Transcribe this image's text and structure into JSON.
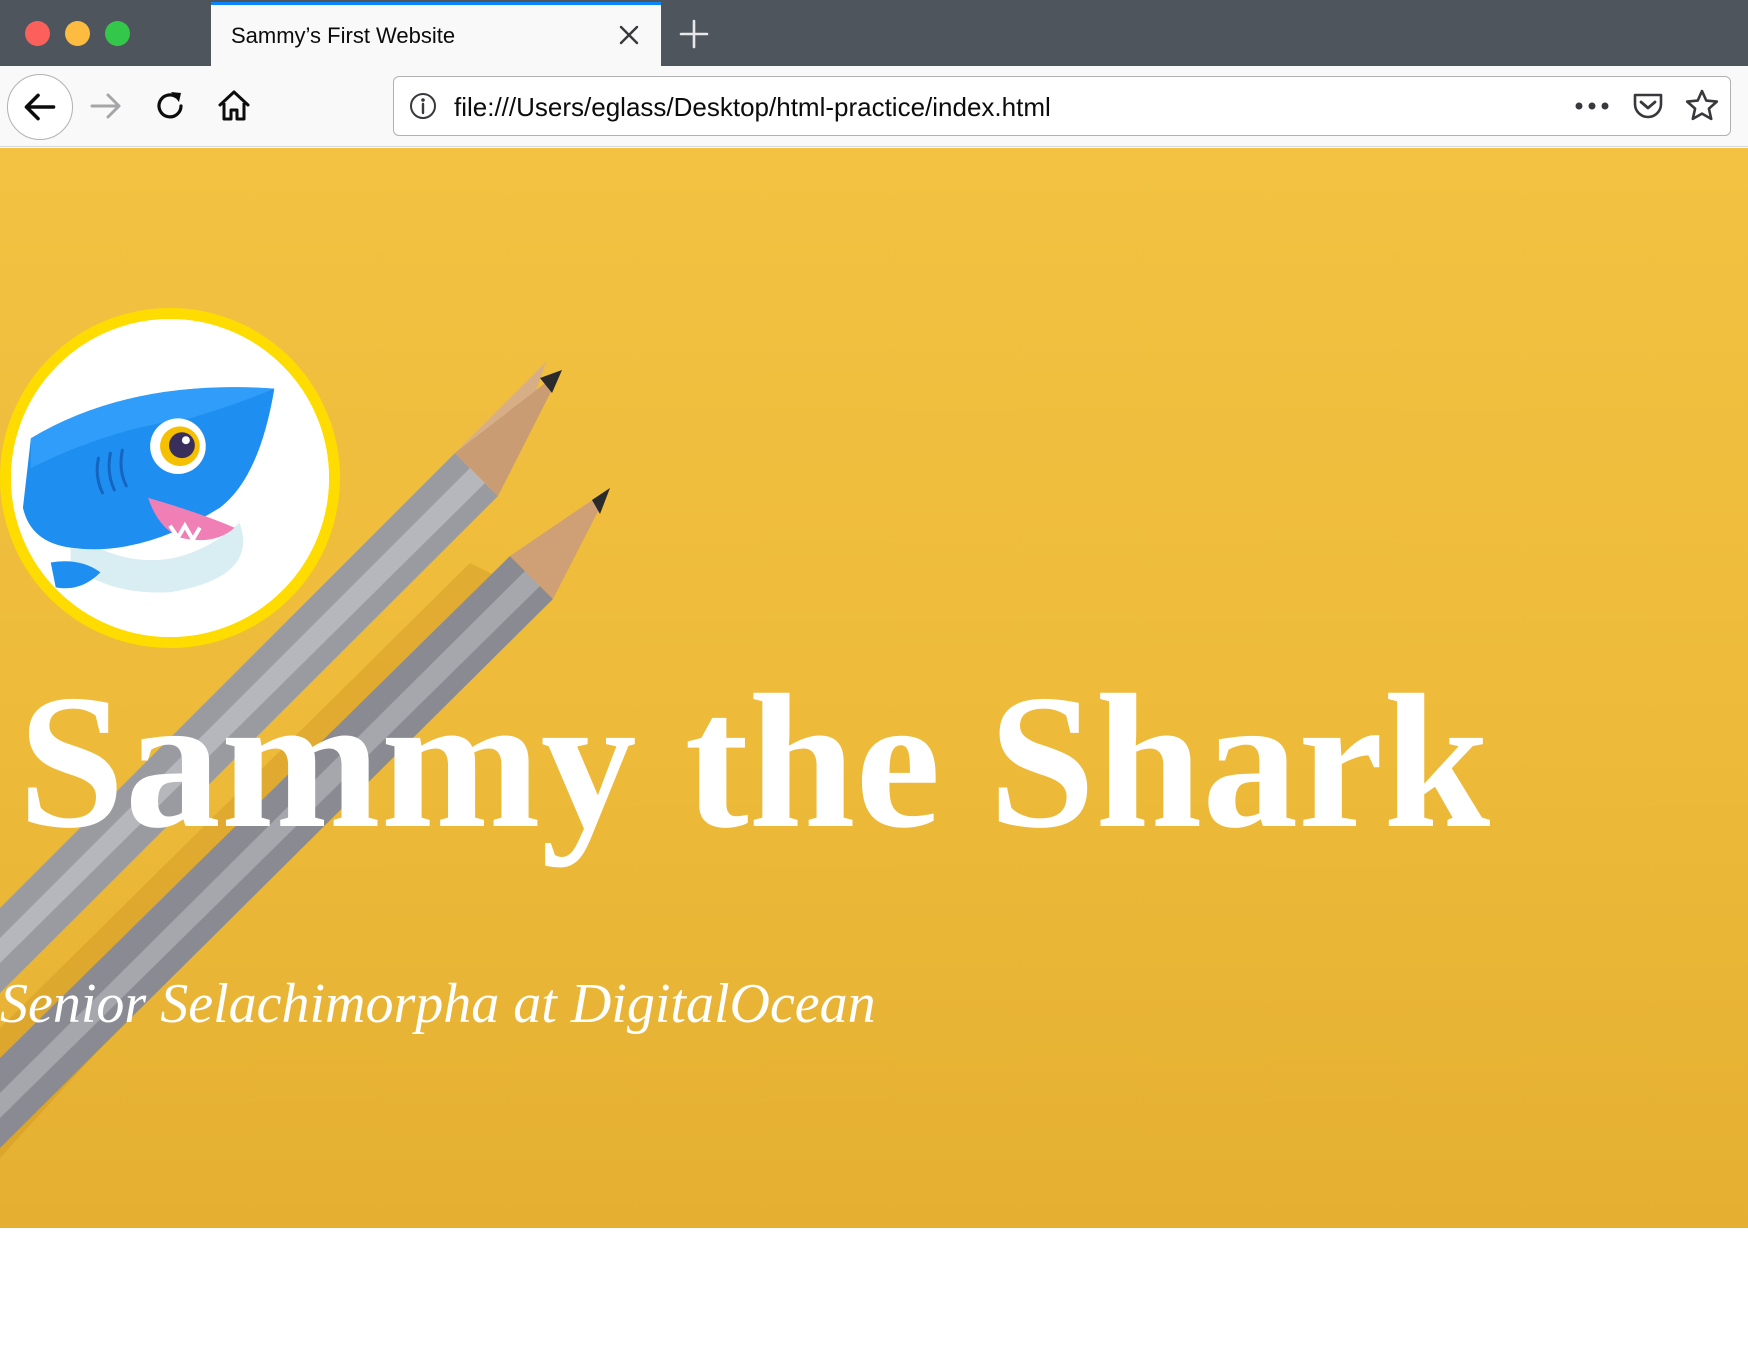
{
  "browser": {
    "tab": {
      "title": "Sammy’s First Website"
    },
    "urlbar": {
      "url": "file:///Users/eglass/Desktop/html-practice/index.html"
    },
    "icons": {
      "close": "close-icon",
      "new_tab": "plus-icon",
      "back": "back-arrow-icon",
      "forward": "forward-arrow-icon",
      "reload": "reload-icon",
      "home": "home-icon",
      "info": "info-icon",
      "more": "more-horizontal-icon",
      "pocket": "pocket-icon",
      "bookmark": "star-icon"
    },
    "colors": {
      "tab_accent": "#0a84ff",
      "traffic_red": "#fc605b",
      "traffic_yellow": "#fdbc40",
      "traffic_green": "#34c84a"
    }
  },
  "page": {
    "title": "Sammy the Shark",
    "subtitle": "Senior Selachimorpha at DigitalOcean",
    "avatar": "shark-avatar",
    "colors": {
      "hero_background": "#f0bd3c",
      "avatar_border": "#ffdc00",
      "text": "#ffffff"
    }
  }
}
